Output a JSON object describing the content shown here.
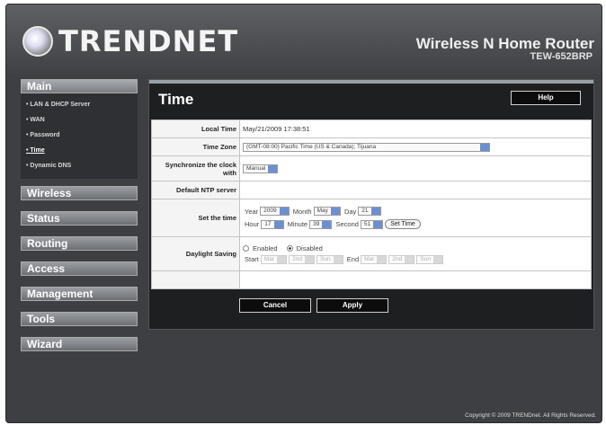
{
  "brand": {
    "logo": "TRENDNET",
    "product": "Wireless N Home Router",
    "model": "TEW-652BRP"
  },
  "sidebar": {
    "main_label": "Main",
    "submenu": [
      "LAN & DHCP Server",
      "WAN",
      "Password",
      "Time",
      "Dynamic DNS"
    ],
    "menus": [
      "Wireless",
      "Status",
      "Routing",
      "Access",
      "Management",
      "Tools",
      "Wizard"
    ]
  },
  "page": {
    "title": "Time",
    "help_label": "Help"
  },
  "form": {
    "local_time_label": "Local Time",
    "local_time_value": "May/21/2009 17:38:51",
    "timezone_label": "Time Zone",
    "timezone_value": "(GMT-08:00) Pacific Time (US & Canada); Tijuana",
    "sync_label": "Synchronize the clock with",
    "sync_value": "Manual",
    "ntp_label": "Default NTP server",
    "ntp_value": "",
    "settime_label": "Set the time",
    "year_label": "Year",
    "year_value": "2009",
    "month_label": "Month",
    "month_value": "May",
    "day_label": "Day",
    "day_value": "21",
    "hour_label": "Hour",
    "hour_value": "17",
    "minute_label": "Minute",
    "minute_value": "39",
    "second_label": "Second",
    "second_value": "51",
    "settime_button": "Set Time",
    "dst_label": "Daylight Saving",
    "enabled_label": "Enabled",
    "disabled_label": "Disabled",
    "dst_selected": "Disabled",
    "start_label": "Start",
    "end_label": "End",
    "month_placeholder": "Mar",
    "week_placeholder": "2nd",
    "day_placeholder": "Sun"
  },
  "buttons": {
    "cancel": "Cancel",
    "apply": "Apply"
  },
  "footer": {
    "copyright": "Copyright © 2009 TRENDnet. All Rights Reserved."
  }
}
